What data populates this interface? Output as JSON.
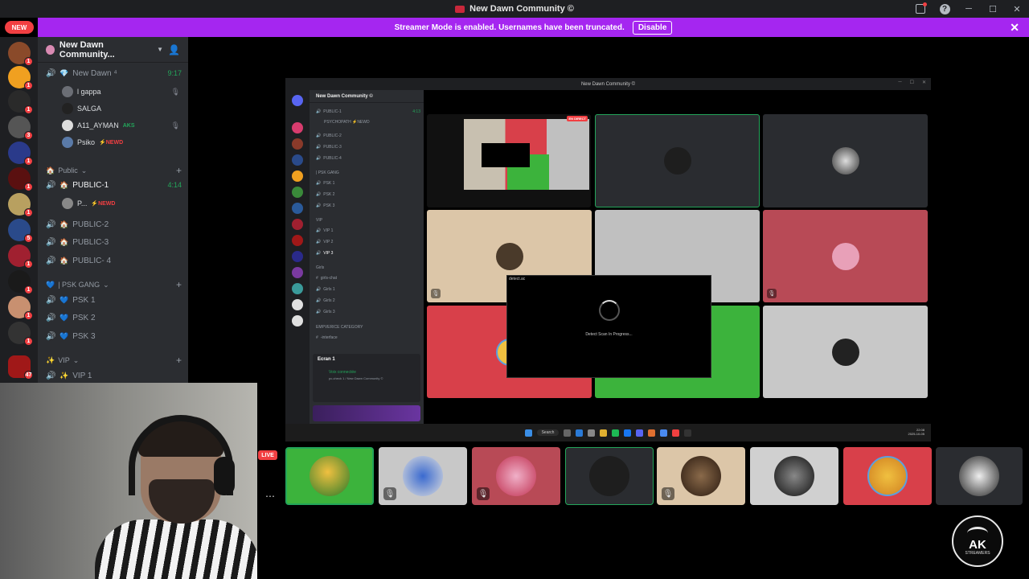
{
  "window": {
    "title": "New Dawn Community ©"
  },
  "banner": {
    "text": "Streamer Mode is enabled. Usernames have been truncated.",
    "button": "Disable"
  },
  "new_badge": "NEW",
  "server": {
    "name": "New Dawn Community..."
  },
  "sidebar": {
    "voice_top": {
      "label": "New Dawn ⁴",
      "time": "9:17"
    },
    "users_top": [
      {
        "name": "l gappa",
        "tag": ""
      },
      {
        "name": "SALGA",
        "tag": ""
      },
      {
        "name": "A11_AYMAN",
        "tag": "AKS"
      },
      {
        "name": "Psiko",
        "tag": "⚡NEWD"
      }
    ],
    "public_cat": "Public",
    "public_channels": [
      {
        "label": "PUBLIC-1",
        "time": "4:14"
      },
      {
        "label": "PUBLIC-2"
      },
      {
        "label": "PUBLIC-3"
      },
      {
        "label": "PUBLIC- 4"
      }
    ],
    "public_user": {
      "name": "P...",
      "tag": "⚡NEWD"
    },
    "psk_cat": "| PSK GANG",
    "psk_channels": [
      "PSK 1",
      "PSK 2",
      "PSK 3"
    ],
    "vip_cat": "VIP",
    "vip_channels": [
      "VIP 1"
    ]
  },
  "shared": {
    "title": "New Dawn Community ©",
    "server": "New Dawn Community ©",
    "lines": [
      "PUBLIC-1",
      "PSYCHOPATH ⚡NEWD",
      "PUBLIC-2",
      "PUBLIC-3",
      "PUBLIC-4",
      "| PSK GANG",
      "PSK 1",
      "PSK 2",
      "PSK 3",
      "VIP",
      "VIP 1",
      "VIP 2",
      "VIP 3",
      "Girls",
      "girls-chat",
      "Girls 1",
      "Girls 2",
      "Girls 3",
      "EMPVERICE CATEGORY",
      "-interface"
    ],
    "line_time": "4:13",
    "voice_title": "Ecran 1",
    "voice_connected": "Voix connectée",
    "voice_channel": "pc-check 1 / New Dawn Community ©",
    "popup_title": "detect.ac",
    "popup_text": "Detect Scan In Progress...",
    "live_tag": "EN DIRECT",
    "taskbar_search": "Search",
    "taskbar_time": "22:08",
    "taskbar_date": "2025-10-05"
  },
  "live_badge": "LIVE",
  "more_icon": "⋯",
  "logo": {
    "text": "AK",
    "sub": "STREAMERS"
  },
  "colors": {
    "accent": "#a526f0",
    "green": "#23a55a",
    "red": "#f23f42"
  }
}
